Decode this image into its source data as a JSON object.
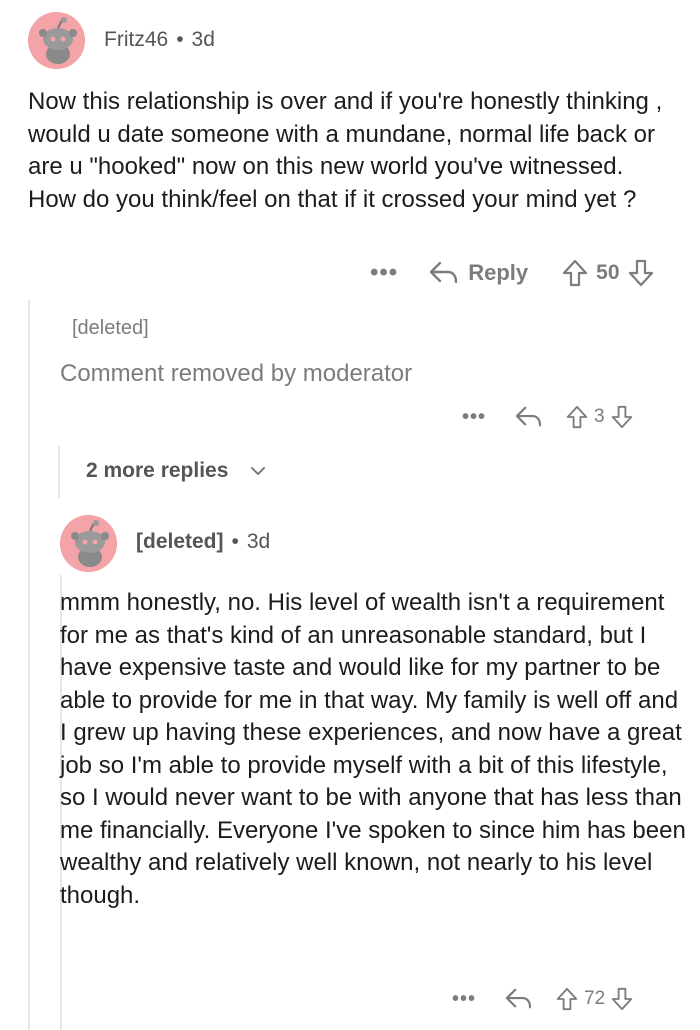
{
  "comment1": {
    "username": "Fritz46",
    "age": "3d",
    "separator": "•",
    "body": "Now this relationship is over and if you're honestly thinking , would u date someone with a mundane, normal life back or are u \"hooked\" now on this new world you've witnessed. How do you think/feel on that if it crossed your mind yet ?",
    "reply_label": "Reply",
    "score": "50",
    "more_label": "•••"
  },
  "comment2": {
    "username": "[deleted]",
    "body": "Comment removed by moderator",
    "score": "3",
    "more_label": "•••"
  },
  "more_replies": {
    "label": "2 more replies"
  },
  "comment3": {
    "username": "[deleted]",
    "age": "3d",
    "separator": "•",
    "body": "mmm honestly, no. His level of wealth isn't a requirement for me as that's kind of an unreasonable standard, but I have expensive taste and would like for my partner to be able to provide for me in that way. My family is well off and I grew up having these experiences, and now have a great job so I'm able to provide myself with a bit of this lifestyle, so I would never want to be with anyone that has less than me financially. Everyone I've spoken to since him has been wealthy and relatively well known, not nearly to his level though.",
    "score": "72",
    "more_label": "•••"
  },
  "colors": {
    "avatar_bg": "#f4a3a8",
    "muted": "#7c7c7c",
    "thread_line": "#e6e6e6"
  }
}
